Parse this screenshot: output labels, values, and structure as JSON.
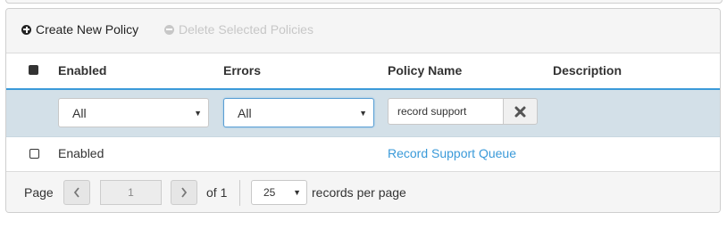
{
  "toolbar": {
    "create_label": "Create New Policy",
    "delete_label": "Delete Selected Policies"
  },
  "table": {
    "columns": [
      "Enabled",
      "Errors",
      "Policy Name",
      "Description"
    ],
    "filters": {
      "enabled_value": "All",
      "errors_value": "All",
      "search_value": "record support"
    },
    "rows": [
      {
        "enabled": "Enabled",
        "errors": "",
        "policy_name": "Record Support Queue",
        "description": ""
      }
    ]
  },
  "pager": {
    "page_label": "Page",
    "current_page": "1",
    "of_label": "of 1",
    "per_page_value": "25",
    "per_page_label": "records per page"
  },
  "colors": {
    "accent": "#3a9ad9",
    "filter_row_bg": "#d3e0e8",
    "panel_bg": "#f5f5f5"
  }
}
